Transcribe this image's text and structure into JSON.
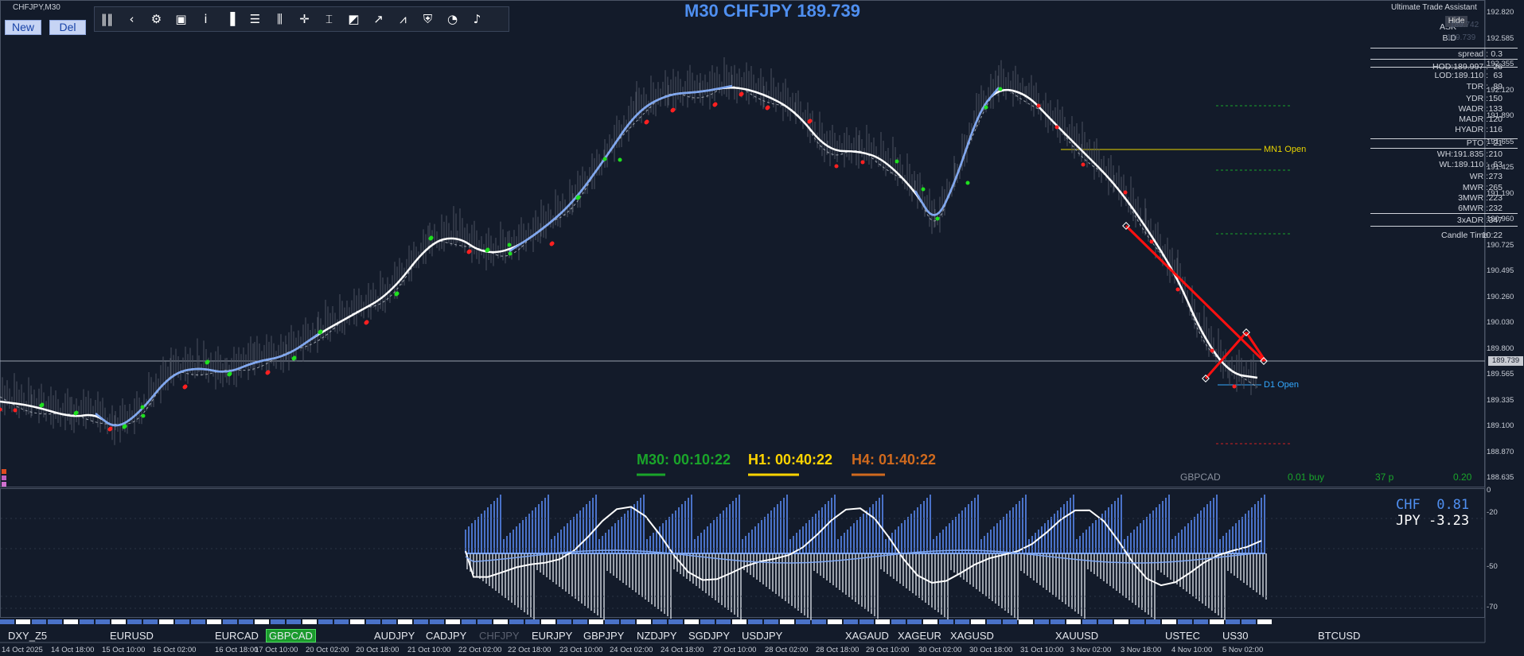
{
  "window": {
    "symbol_timeframe": "CHFJPY,M30",
    "title": "M30 CHFJPY 189.739"
  },
  "buttons": {
    "new": "New",
    "del": "Del"
  },
  "toolbar": {
    "icons": [
      "grip-icon",
      "chevron-left-icon",
      "gear-icon",
      "camera-icon",
      "info-icon",
      "bar-chart-icon",
      "list-icon",
      "candle-settings-icon",
      "crosshair-icon",
      "fibo-icon",
      "eraser-icon",
      "trend-icon",
      "zigzag-icon",
      "shield-icon",
      "pie-icon",
      "bell-icon"
    ]
  },
  "assistant": {
    "title": "Ultimate Trade Assistant",
    "hide": "Hide",
    "rows": [
      {
        "k": "ASK",
        "v": ""
      },
      {
        "k": "BID",
        "v": ""
      },
      {
        "k": "spread :",
        "v": "0.3"
      },
      {
        "k": "HOD:189.997 :",
        "v": "26"
      },
      {
        "k": "LOD:189.110 :",
        "v": "63"
      },
      {
        "k": "TDR :",
        "v": "89"
      },
      {
        "k": "YDR :",
        "v": "150"
      },
      {
        "k": "WADR :",
        "v": "133"
      },
      {
        "k": "MADR :",
        "v": "120"
      },
      {
        "k": "HYADR :",
        "v": "116"
      },
      {
        "k": "PTO :",
        "v": "21"
      },
      {
        "k": "WH:191.835 :",
        "v": "210"
      },
      {
        "k": "WL:189.110 :",
        "v": "63"
      },
      {
        "k": "WR :",
        "v": "273"
      },
      {
        "k": "MWR :",
        "v": "265"
      },
      {
        "k": "3MWR :",
        "v": "223"
      },
      {
        "k": "6MWR :",
        "v": "232"
      },
      {
        "k": "3xADR :",
        "v": "347"
      },
      {
        "k": "Candle Time",
        "v": "10:22"
      }
    ],
    "ask_value": "189.742",
    "bid_value": "189.739"
  },
  "price_axis": [
    "192.820",
    "192.585",
    "192.355",
    "192.120",
    "191.890",
    "191.655",
    "191.425",
    "191.190",
    "190.960",
    "190.725",
    "190.495",
    "190.260",
    "190.030",
    "189.800",
    "189.565",
    "189.335",
    "189.100",
    "188.870",
    "188.635"
  ],
  "current_price": "189.739",
  "levels": {
    "mn1": "MN1 Open",
    "d1": "D1 Open"
  },
  "timers": {
    "m30": "M30: 00:10:22",
    "h1": "H1: 00:40:22",
    "h4": "H4: 01:40:22"
  },
  "trade_info": {
    "symbol": "GBPCAD",
    "lot": "0.01 buy",
    "pips": "37 p",
    "profit": "0.20"
  },
  "sub_axis": [
    "0",
    "-20",
    "-50",
    "-70"
  ],
  "currency_strength": {
    "chf_label": "CHF",
    "chf_value": "0.81",
    "jpy_label": "JPY",
    "jpy_value": "-3.23"
  },
  "symbols": [
    "DXY_Z5",
    "EURUSD",
    "EURCAD",
    "GBPCAD",
    "AUDJPY",
    "CADJPY",
    "CHFJPY",
    "EURJPY",
    "GBPJPY",
    "NZDJPY",
    "SGDJPY",
    "USDJPY",
    "XAGAUD",
    "XAGEUR",
    "XAGUSD",
    "XAUUSD",
    "USTEC",
    "US30",
    "BTCUSD"
  ],
  "dates": [
    "14 Oct 2025",
    "14 Oct 18:00",
    "15 Oct 10:00",
    "16 Oct 02:00",
    "16 Oct 18:00",
    "17 Oct 10:00",
    "20 Oct 02:00",
    "20 Oct 18:00",
    "21 Oct 10:00",
    "22 Oct 02:00",
    "22 Oct 18:00",
    "23 Oct 10:00",
    "24 Oct 02:00",
    "24 Oct 18:00",
    "27 Oct 10:00",
    "28 Oct 02:00",
    "28 Oct 18:00",
    "29 Oct 10:00",
    "30 Oct 02:00",
    "30 Oct 18:00",
    "31 Oct 10:00",
    "3 Nov 02:00",
    "3 Nov 18:00",
    "4 Nov 10:00",
    "5 Nov 02:00"
  ],
  "colors": {
    "bg": "#131b2a",
    "title": "#4f8ff0",
    "m30": "#1aa52a",
    "h1": "#ffd400",
    "h4": "#d06a1e",
    "mn1": "#e8d400",
    "d1": "#33a8ff",
    "trend": "#ff1010",
    "ma_blue": "#7ea6f0"
  }
}
